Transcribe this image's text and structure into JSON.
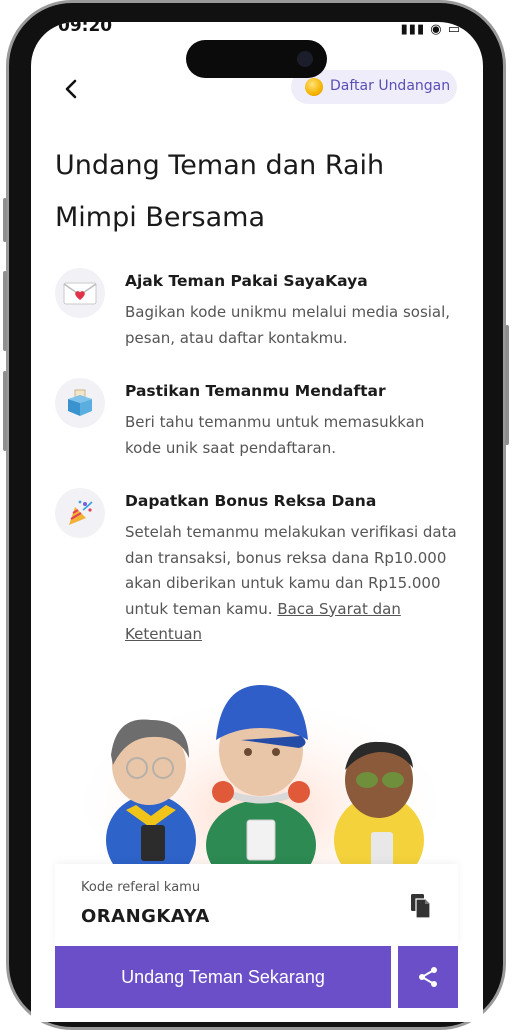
{
  "status_bar": {
    "time": "09:20",
    "icons": "▮▮▮ ◉ ▭"
  },
  "header": {
    "invite_list_label": "Daftar Undangan"
  },
  "title": {
    "line1": "Undang Teman dan Raih",
    "line2": "Mimpi Bersama"
  },
  "steps": [
    {
      "icon": "love-letter-icon",
      "title": "Ajak Teman Pakai SayaKaya",
      "desc": "Bagikan kode unikmu melalui media sosial, pesan, atau daftar kontakmu."
    },
    {
      "icon": "ballot-box-icon",
      "title": "Pastikan Temanmu Mendaftar",
      "desc": "Beri tahu temanmu untuk memasukkan kode unik saat pendaftaran."
    },
    {
      "icon": "party-popper-icon",
      "title": "Dapatkan Bonus Reksa Dana",
      "desc": "Setelah temanmu melakukan verifikasi data dan transaksi, bonus reksa dana Rp10.000 akan diberikan untuk kamu dan Rp15.000 untuk teman kamu.",
      "link": "Baca Syarat dan Ketentuan"
    }
  ],
  "referral": {
    "label": "Kode referal kamu",
    "code": "ORANGKAYA"
  },
  "cta": {
    "label": "Undang Teman Sekarang"
  },
  "colors": {
    "accent": "#6a4fc8",
    "chip_bg": "#efedfa",
    "chip_text": "#5a4fb5"
  }
}
